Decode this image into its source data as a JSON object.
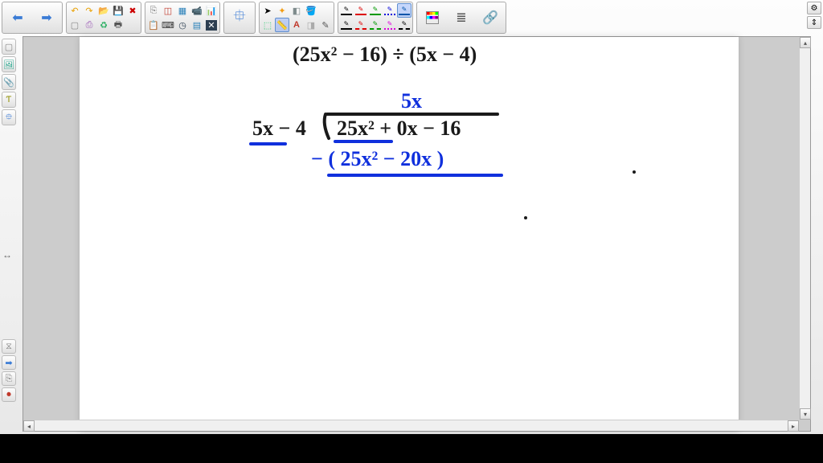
{
  "math": {
    "problem": "(25x² − 16) ÷ (5x − 4)",
    "quotient": "5x",
    "divisor": "5x − 4",
    "dividend": "25x² + 0x − 16",
    "subtract_line": "− ( 25x² − 20x )"
  },
  "colors": {
    "black": "#1a1a1a",
    "blue": "#1030dd"
  },
  "toolbar": {
    "nav": [
      "back",
      "forward"
    ],
    "file_g1": [
      "undo",
      "redo",
      "open",
      "save",
      "delete-x"
    ],
    "file_g2": [
      "blank",
      "screenshot",
      "recycle",
      "print"
    ],
    "insert_g1": [
      "copy",
      "shapes",
      "grid",
      "webcam",
      "poll"
    ],
    "insert_g2": [
      "paste",
      "keyboard",
      "clock",
      "table",
      "close-x"
    ],
    "puzzle": "puzzle",
    "tools_g1": [
      "cursor",
      "spotlight",
      "eraser-g",
      "bucket"
    ],
    "tools_g2": [
      "select",
      "ruler",
      "text-a",
      "eraser-w",
      "eyedropper"
    ],
    "pens": [
      {
        "id": "pen-black-thin",
        "color": "#000",
        "style": "solid"
      },
      {
        "id": "pen-red",
        "color": "#d00",
        "style": "solid"
      },
      {
        "id": "pen-green",
        "color": "#090",
        "style": "solid"
      },
      {
        "id": "pen-blue-dot",
        "color": "#00d",
        "style": "dotted"
      },
      {
        "id": "pen-blue-thick",
        "color": "#05a",
        "style": "solid",
        "active": true
      },
      {
        "id": "pen-black",
        "color": "#000",
        "style": "solid"
      },
      {
        "id": "pen-red-dash",
        "color": "#d00",
        "style": "dashed"
      },
      {
        "id": "pen-green-dash",
        "color": "#090",
        "style": "dashed"
      },
      {
        "id": "pen-magenta",
        "color": "#d0d",
        "style": "dotted"
      },
      {
        "id": "pen-black-dash",
        "color": "#000",
        "style": "dashed"
      }
    ],
    "misc": [
      "color-grid",
      "line-options",
      "link"
    ],
    "right": [
      "settings",
      "expand-vert"
    ]
  },
  "sidebar": {
    "top": [
      "page",
      "image",
      "clip",
      "text-tool",
      "puzzle-side"
    ],
    "bottom": [
      "time",
      "arrow-r",
      "copy-b",
      "stop-rec"
    ]
  }
}
